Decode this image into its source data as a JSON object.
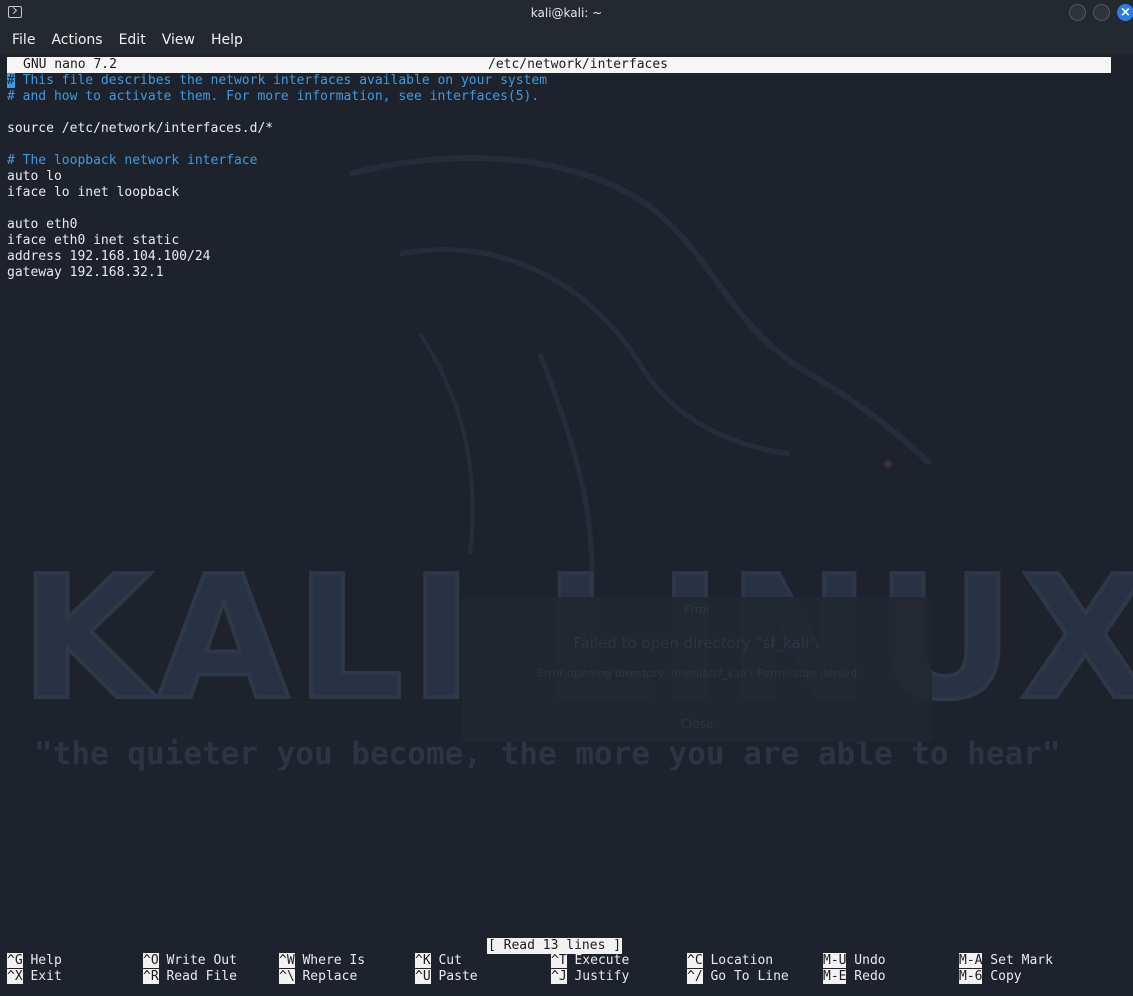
{
  "window": {
    "title": "kali@kali: ~"
  },
  "menubar": {
    "items": [
      "File",
      "Actions",
      "Edit",
      "View",
      "Help"
    ]
  },
  "nano": {
    "version": "GNU nano 7.2",
    "filename": "/etc/network/interfaces",
    "lines": [
      "# This file describes the network interfaces available on your system",
      "# and how to activate them. For more information, see interfaces(5).",
      "",
      "source /etc/network/interfaces.d/*",
      "",
      "# The loopback network interface",
      "auto lo",
      "iface lo inet loopback",
      "",
      "auto eth0",
      "iface eth0 inet static",
      "address 192.168.104.100/24",
      "gateway 192.168.32.1"
    ],
    "status": "[ Read 13 lines ]",
    "shortcuts": [
      [
        {
          "key": "^G",
          "label": "Help"
        },
        {
          "key": "^X",
          "label": "Exit"
        }
      ],
      [
        {
          "key": "^O",
          "label": "Write Out"
        },
        {
          "key": "^R",
          "label": "Read File"
        }
      ],
      [
        {
          "key": "^W",
          "label": "Where Is"
        },
        {
          "key": "^\\",
          "label": "Replace"
        }
      ],
      [
        {
          "key": "^K",
          "label": "Cut"
        },
        {
          "key": "^U",
          "label": "Paste"
        }
      ],
      [
        {
          "key": "^T",
          "label": "Execute"
        },
        {
          "key": "^J",
          "label": "Justify"
        }
      ],
      [
        {
          "key": "^C",
          "label": "Location"
        },
        {
          "key": "^/",
          "label": "Go To Line"
        }
      ],
      [
        {
          "key": "M-U",
          "label": "Undo"
        },
        {
          "key": "M-E",
          "label": "Redo"
        }
      ],
      [
        {
          "key": "M-A",
          "label": "Set Mark"
        },
        {
          "key": "M-6",
          "label": "Copy"
        }
      ]
    ]
  },
  "wallpaper": {
    "logo_text": "KALI LINUX",
    "quote": "\"the quieter you become, the more you are able to hear\""
  },
  "background_dialog": {
    "title": "Error",
    "heading": "Failed to open directory \"sf_kali\".",
    "message": "Error opening directory '/media/sf_kali': Permission denied",
    "button": "Close"
  }
}
